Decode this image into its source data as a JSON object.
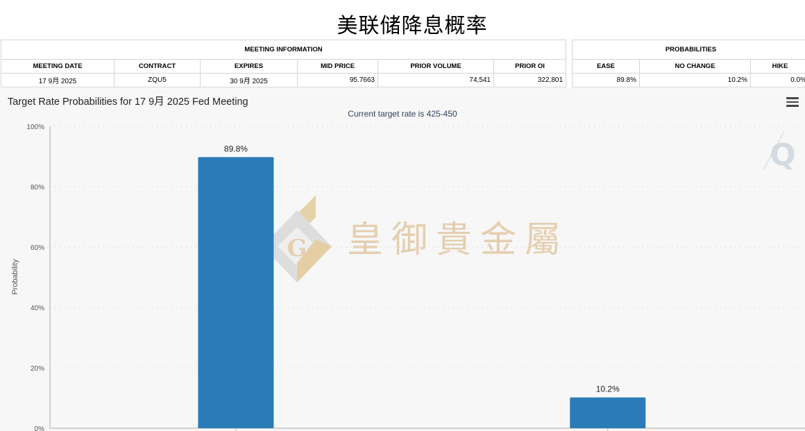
{
  "page_title": "美联储降息概率",
  "meeting_info": {
    "group_label": "MEETING INFORMATION",
    "columns": [
      "MEETING DATE",
      "CONTRACT",
      "EXPIRES",
      "MID PRICE",
      "PRIOR VOLUME",
      "PRIOR OI"
    ],
    "row": [
      "17 9月 2025",
      "ZQU5",
      "30 9月 2025",
      "95.7663",
      "74,541",
      "322,801"
    ]
  },
  "probabilities": {
    "group_label": "PROBABILITIES",
    "columns": [
      "EASE",
      "NO CHANGE",
      "HIKE"
    ],
    "row": [
      "89.8%",
      "10.2%",
      "0.0%"
    ]
  },
  "chart": {
    "title": "Target Rate Probabilities for 17 9月 2025 Fed Meeting",
    "subtitle": "Current target rate is 425-450"
  },
  "watermark": {
    "text": "皇御貴金屬",
    "logo_letter": "G",
    "corner_letter": "Q"
  },
  "chart_data": {
    "type": "bar",
    "categories": [
      "",
      ""
    ],
    "values": [
      89.8,
      10.2
    ],
    "data_labels": [
      "89.8%",
      "10.2%"
    ],
    "title": "Target Rate Probabilities for 17 9月 2025 Fed Meeting",
    "subtitle": "Current target rate is 425-450",
    "xlabel": "",
    "ylabel": "Probability",
    "ylim": [
      0,
      100
    ],
    "yticks": [
      0,
      20,
      40,
      60,
      80,
      100
    ],
    "ytick_labels": [
      "0%",
      "20%",
      "40%",
      "60%",
      "80%",
      "100%"
    ],
    "grid": true,
    "bar_color": "#2b7bb8"
  }
}
